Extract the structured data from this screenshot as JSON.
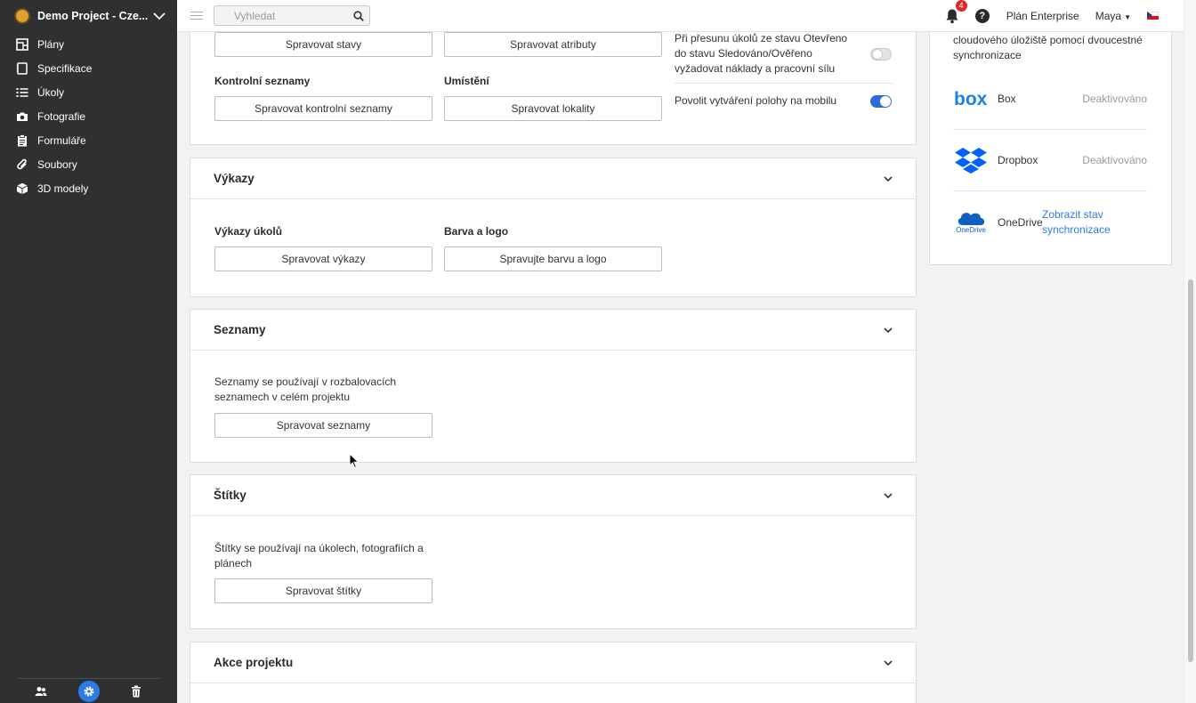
{
  "sidebar": {
    "project_name": "Demo Project - Cze...",
    "items": [
      {
        "label": "Plány",
        "icon": "plans-icon"
      },
      {
        "label": "Specifikace",
        "icon": "specifications-icon"
      },
      {
        "label": "Úkoly",
        "icon": "tasks-icon"
      },
      {
        "label": "Fotografie",
        "icon": "camera-icon"
      },
      {
        "label": "Formuláře",
        "icon": "forms-icon"
      },
      {
        "label": "Soubory",
        "icon": "paperclip-icon"
      },
      {
        "label": "3D modely",
        "icon": "cube-icon"
      }
    ],
    "footer_icons": [
      "users-icon",
      "settings-icon",
      "trash-icon"
    ]
  },
  "topbar": {
    "search_placeholder": "Vyhledat",
    "notification_count": "4",
    "help": "?",
    "plan": "Plán Enterprise",
    "user": "Maya",
    "language_flag": "cz-flag-icon"
  },
  "tasks_card": {
    "btn_states": "Spravovat stavy",
    "btn_attributes": "Spravovat atributy",
    "label_checklists": "Kontrolní seznamy",
    "btn_checklists": "Spravovat kontrolní seznamy",
    "label_locations": "Umístění",
    "btn_locations": "Spravovat lokality",
    "toggle1_text": "Při přesunu úkolů ze stavu Otevřeno do stavu Sledováno/Ověřeno vyžadovat náklady a pracovní sílu",
    "toggle1_on": false,
    "toggle2_text": "Povolit vytváření polohy na mobilu",
    "toggle2_on": true
  },
  "reports_card": {
    "title": "Výkazy",
    "label_task_reports": "Výkazy úkolů",
    "btn_reports": "Spravovat výkazy",
    "label_color_logo": "Barva a logo",
    "btn_color_logo": "Spravujte barvu a logo"
  },
  "lists_card": {
    "title": "Seznamy",
    "description": "Seznamy se používají v rozbalovacích seznamech v celém projektu",
    "btn": "Spravovat seznamy"
  },
  "tags_card": {
    "title": "Štítky",
    "description": "Štítky se používají na úkolech, fotografiích a plánech",
    "btn": "Spravovat štítky"
  },
  "actions_card": {
    "title": "Akce projektu"
  },
  "cloud_panel": {
    "intro": "cloudového úložiště pomocí dvoucestné synchronizace",
    "services": [
      {
        "name": "Box",
        "status": "Deaktivováno",
        "logo": "box-logo-icon"
      },
      {
        "name": "Dropbox",
        "status": "Deaktivováno",
        "logo": "dropbox-logo-icon"
      },
      {
        "name": "OneDrive",
        "link": "Zobrazit stav synchronizace",
        "logo": "onedrive-logo-icon",
        "logo_text": "OneDrive"
      }
    ]
  },
  "colors": {
    "sidebar_bg": "#2e3032",
    "accent": "#2d7be5",
    "toggle_on": "#2d6bd7",
    "badge": "#e02828"
  }
}
